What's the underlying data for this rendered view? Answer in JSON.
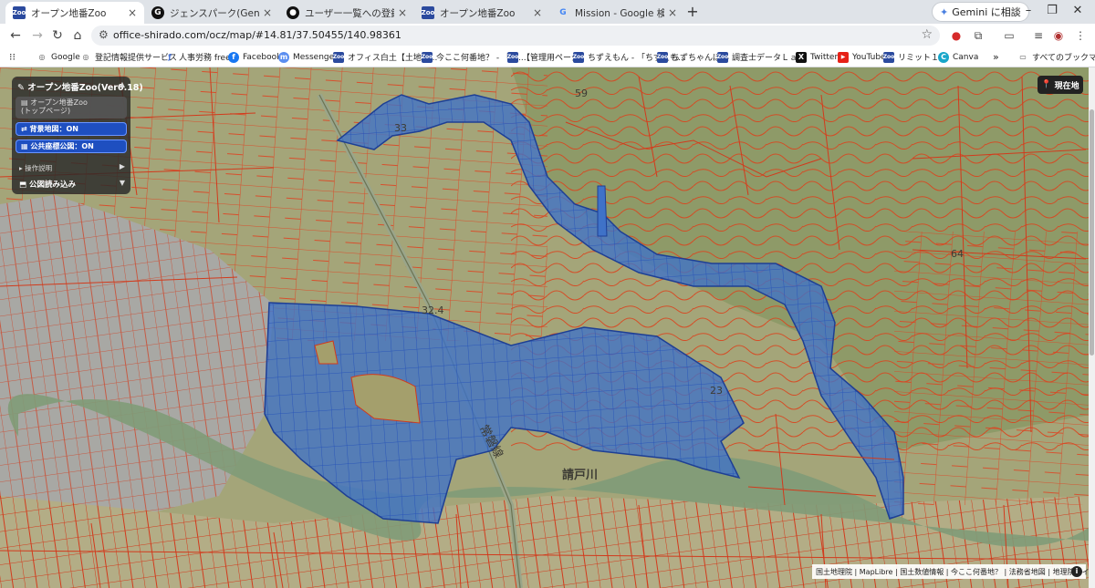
{
  "tabs": [
    {
      "title": "オープン地番Zoo",
      "favicon": "zoo-icon",
      "active": true
    },
    {
      "title": "ジェンスパーク(Genspark) - あなたの",
      "favicon": "genspark-icon",
      "active": false
    },
    {
      "title": "ユーザー一覧への登録筆数表示の",
      "favicon": "github-icon",
      "active": false
    },
    {
      "title": "オープン地番Zoo",
      "favicon": "zoo-icon",
      "active": false
    },
    {
      "title": "Mission - Google 検索",
      "favicon": "google-icon",
      "active": false
    }
  ],
  "gemini_button": "Gemini に相談",
  "address": {
    "url": "office-shirado.com/ocz/map/#14.81/37.50455/140.98361"
  },
  "bookmarks": [
    {
      "label": "Google",
      "icon": "globe-icon"
    },
    {
      "label": "登記情報提供サービス",
      "icon": "globe-icon"
    },
    {
      "label": "人事労務 freee",
      "icon": "freee-icon"
    },
    {
      "label": "Facebook",
      "icon": "facebook-icon"
    },
    {
      "label": "Messenger",
      "icon": "messenger-icon"
    },
    {
      "label": "オフィス白土【土地家...",
      "icon": "zoo-icon"
    },
    {
      "label": "今ここ何番地？ - 「今...",
      "icon": "zoo-icon"
    },
    {
      "label": "【管理用ページ】",
      "icon": "zoo-icon"
    },
    {
      "label": "ちずえもん - 「ちずえも...",
      "icon": "zoo-icon"
    },
    {
      "label": "ちずちゃんぽん",
      "icon": "zoo-icon"
    },
    {
      "label": "調査士データＬａｂ",
      "icon": "zoo-icon"
    },
    {
      "label": "Twitter",
      "icon": "x-icon"
    },
    {
      "label": "YouTube",
      "icon": "youtube-icon"
    },
    {
      "label": "リミット１２",
      "icon": "zoo-icon"
    },
    {
      "label": "Canva",
      "icon": "canva-icon"
    }
  ],
  "bookmarks_more": "»",
  "all_bookmarks": "すべてのブックマーク",
  "panel": {
    "title": "オープン地番Zoo(Ver0.18)",
    "home_line1": "オープン地番Zoo",
    "home_line2": "(トップページ)",
    "background_map": "背景地図：ON",
    "public_map": "公共座標公図：ON",
    "operation": "操作説明",
    "load": "公図読み込み"
  },
  "current_location": "現在地",
  "attribution": "国土地理院 | MapLibre | 国土数値情報 | 今ここ何番地？ | 法務省地図 | 地理院タイル",
  "map_labels": [
    {
      "text": "59"
    },
    {
      "text": "33"
    },
    {
      "text": "32.4"
    },
    {
      "text": "64"
    },
    {
      "text": "23"
    },
    {
      "text": "請戸川"
    },
    {
      "text": "常磐線"
    }
  ]
}
